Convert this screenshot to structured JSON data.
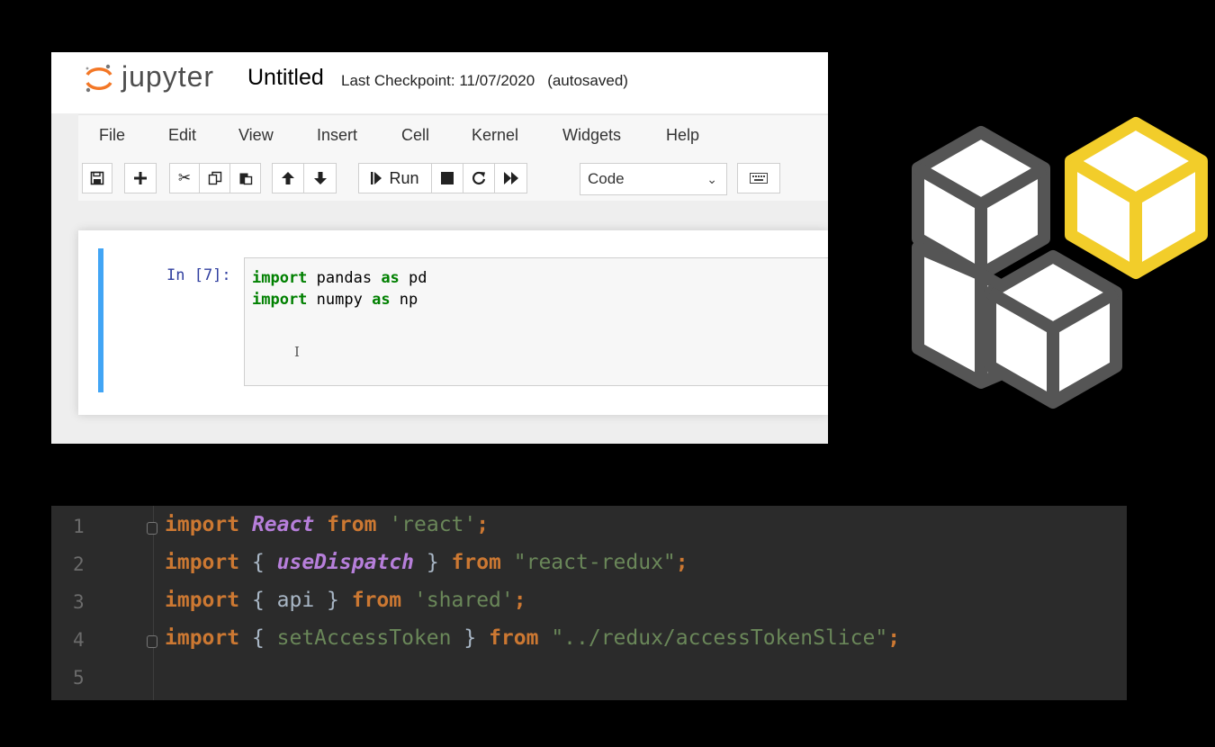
{
  "jupyter": {
    "logo_text": "jupyter",
    "notebook_title": "Untitled",
    "checkpoint_label": "Last Checkpoint: 11/07/2020",
    "autosave_status": "(autosaved)",
    "menu": [
      "File",
      "Edit",
      "View",
      "Insert",
      "Cell",
      "Kernel",
      "Widgets",
      "Help"
    ],
    "toolbar": {
      "run_label": "Run",
      "cell_type": "Code",
      "icons": [
        "save-icon",
        "plus-icon",
        "scissors-icon",
        "copy-icon",
        "paste-icon",
        "arrow-up-icon",
        "arrow-down-icon",
        "run-icon",
        "stop-icon",
        "restart-icon",
        "fast-forward-icon",
        "keyboard-icon"
      ]
    },
    "cell": {
      "prompt": "In [7]:",
      "lines": [
        {
          "keyword": "import",
          "name": " pandas ",
          "keyword2": "as",
          "alias": " pd"
        },
        {
          "keyword": "import",
          "name": " numpy ",
          "keyword2": "as",
          "alias": " np"
        }
      ]
    },
    "colors": {
      "accent": "#42a5f5",
      "keyword": "#008000",
      "prompt": "#303f9f",
      "logo_orange": "#f37726"
    }
  },
  "logo": {
    "icon": "cubes-icon",
    "colors": {
      "outline": "#555555",
      "highlight": "#f2cd2a",
      "face": "#ffffff"
    }
  },
  "editor": {
    "line_numbers": [
      "1",
      "2",
      "3",
      "4",
      "5"
    ],
    "lines": [
      {
        "kw": "import",
        "s1": " ",
        "cls": "React",
        "s2": " ",
        "kw2": "from",
        "s3": " ",
        "str": "'react'",
        "end": ";"
      },
      {
        "kw": "import",
        "s1": " { ",
        "cls": "useDispatch",
        "s2": " } ",
        "kw2": "from",
        "s3": " ",
        "str": "\"react-redux\"",
        "end": ";"
      },
      {
        "kw": "import",
        "s1": " { api } ",
        "kw2": "from",
        "s3": " ",
        "str": "'shared'",
        "end": ";"
      },
      {
        "kw": "import",
        "s1": " { ",
        "imp": "setAccessToken",
        "s2": " } ",
        "kw2": "from",
        "s3": " ",
        "str": "\"../redux/accessTokenSlice\"",
        "end": ";"
      }
    ],
    "colors": {
      "background": "#2b2b2b",
      "keyword": "#cc7832",
      "string": "#6a8759",
      "class": "#b77fdb",
      "text": "#a9b7c6"
    }
  }
}
